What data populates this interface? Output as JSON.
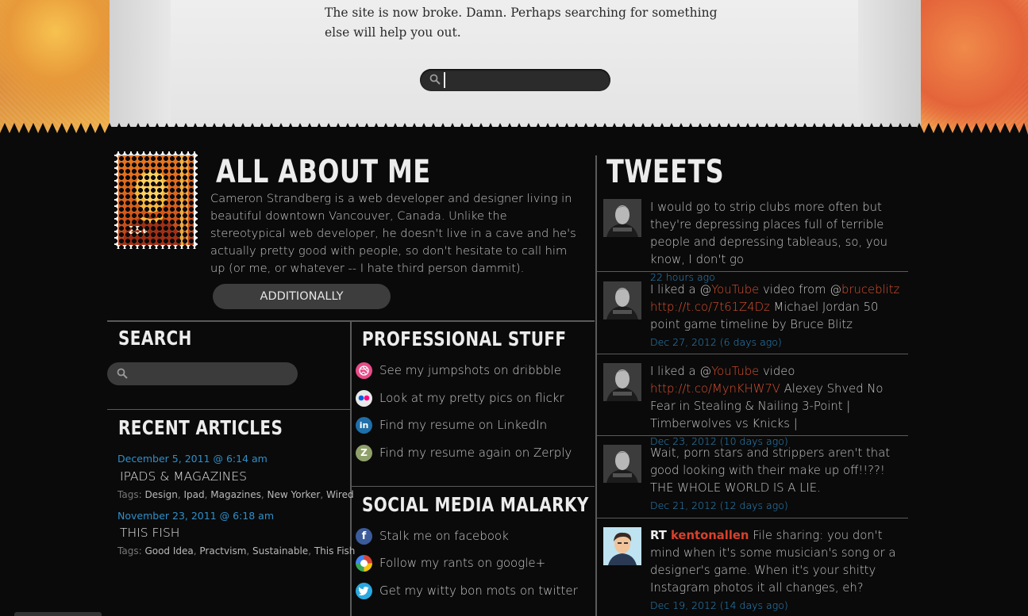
{
  "notfound": {
    "message": "The site is now broke. Damn. Perhaps searching for something else will help you out.",
    "search_value": ""
  },
  "about": {
    "heading": "ALL ABOUT ME",
    "stamp_price": "25¢",
    "bio": "Cameron Strandberg is a web developer and designer living in beautiful downtown Vancouver, Canada. Unlike the stereotypical web developer, he doesn't live in a cave and he's actually pretty good with people, so don't hesitate to call him up (or me, or whatever -- I hate third person dammit).",
    "button_label": "ADDITIONALLY"
  },
  "search": {
    "heading": "SEARCH",
    "value": ""
  },
  "recent_articles": {
    "heading": "RECENT ARTICLES",
    "tags_prefix": "Tags:",
    "items": [
      {
        "date": "December 5, 2011 @ 6:14 am",
        "title": "IPADS & MAGAZINES",
        "tags": [
          "Design",
          "Ipad",
          "Magazines",
          "New Yorker",
          "Wired"
        ]
      },
      {
        "date": "November 23, 2011 @ 6:18 am",
        "title": "THIS FISH",
        "tags": [
          "Good Idea",
          "Practvism",
          "Sustainable",
          "This Fish"
        ]
      }
    ]
  },
  "professional": {
    "heading": "PROFESSIONAL STUFF",
    "links": [
      {
        "icon": "dribbble-icon",
        "label": "See my jumpshots on dribbble"
      },
      {
        "icon": "flickr-icon",
        "label": "Look at my pretty pics on flickr"
      },
      {
        "icon": "linkedin-icon",
        "label": "Find my resume on LinkedIn"
      },
      {
        "icon": "zerply-icon",
        "label": "Find my resume again on Zerply"
      }
    ]
  },
  "social": {
    "heading": "SOCIAL MEDIA MALARKY",
    "links": [
      {
        "icon": "facebook-icon",
        "label": "Stalk me on facebook"
      },
      {
        "icon": "google-plus-icon",
        "label": "Follow my rants on google+"
      },
      {
        "icon": "twitter-icon",
        "label": "Get my witty bon mots on twitter"
      }
    ]
  },
  "tweets": {
    "heading": "TWEETS",
    "items": [
      {
        "parts": [
          {
            "t": "I would go to strip clubs more often but they're depressing places full of terrible people and depressing tableaus, so, you know, I don't go"
          }
        ],
        "time": "22 hours ago"
      },
      {
        "parts": [
          {
            "t": "I liked a @"
          },
          {
            "t": "YouTube",
            "link": true
          },
          {
            "t": " video from @"
          },
          {
            "t": "bruceblitz",
            "link": true
          },
          {
            "t": " "
          },
          {
            "t": "http://t.co/7t61Z4Dz",
            "link": true
          },
          {
            "t": " Michael Jordan 50 point game timeline by Bruce Blitz"
          }
        ],
        "time": "Dec 27, 2012 (6 days ago)"
      },
      {
        "parts": [
          {
            "t": "I liked a @"
          },
          {
            "t": "YouTube",
            "link": true
          },
          {
            "t": " video "
          },
          {
            "t": "http://t.co/MynKHW7V",
            "link": true
          },
          {
            "t": " Alexey Shved No Fear in Stealing & Nailing 3-Point | Timberwolves vs Knicks |"
          }
        ],
        "time": "Dec 23, 2012 (10 days ago)"
      },
      {
        "parts": [
          {
            "t": "Wait, porn stars and strippers aren't that good looking with their make up off!!??! THE WHOLE WORLD IS A LIE."
          }
        ],
        "time": "Dec 21, 2012 (12 days ago)"
      },
      {
        "parts": [
          {
            "t": "RT ",
            "rt": true
          },
          {
            "t": "kentonallen",
            "user": true
          },
          {
            "t": " File sharing: you don't mind when it's some musician's song or a designer's game. When it's your shitty Instagram photos it all changes, eh?"
          }
        ],
        "time": "Dec 19, 2012 (14 days ago)"
      }
    ]
  },
  "colors": {
    "accent_blue": "#2f8fc9",
    "link_red": "#d9502f",
    "background": "#0a0a0a"
  }
}
